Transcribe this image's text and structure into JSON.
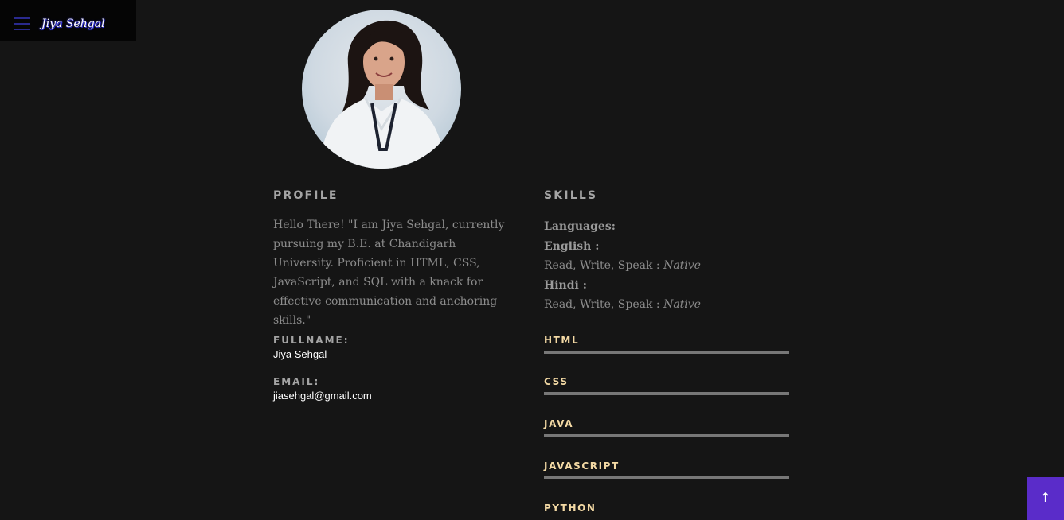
{
  "header": {
    "site_name": "Jiya Sehgal",
    "menu_icon": "hamburger-icon"
  },
  "avatar": {
    "alt": "Jiya Sehgal"
  },
  "profile": {
    "title": "PROFILE",
    "text": "Hello There! \"I am Jiya Sehgal, currently pursuing my B.E. at Chandigarh University. Proficient in HTML, CSS, JavaScript, and SQL with a knack for effective communication and anchoring skills.\"",
    "fullname_label": "FULLNAME:",
    "fullname_value": "Jiya Sehgal",
    "email_label": "EMAIL:",
    "email_value": "jiasehgal@gmail.com"
  },
  "skills": {
    "title": "SKILLS",
    "languages_label": "Languages:",
    "languages": [
      {
        "name": "English :",
        "level_text": "Read, Write, Speak : ",
        "level": "Native"
      },
      {
        "name": "Hindi :",
        "level_text": "Read, Write, Speak : ",
        "level": "Native"
      }
    ],
    "items": [
      {
        "label": "HTML"
      },
      {
        "label": "CSS"
      },
      {
        "label": "JAVA"
      },
      {
        "label": "JAVASCRIPT"
      },
      {
        "label": "PYTHON"
      }
    ]
  },
  "back_to_top": {
    "icon": "arrow-up-icon",
    "glyph": "↑"
  },
  "colors": {
    "background": "#151515",
    "header_bg": "#050505",
    "accent_purple": "#5a2cc9",
    "skill_label": "#f3d9a4",
    "muted_text": "#8c8c8c"
  }
}
